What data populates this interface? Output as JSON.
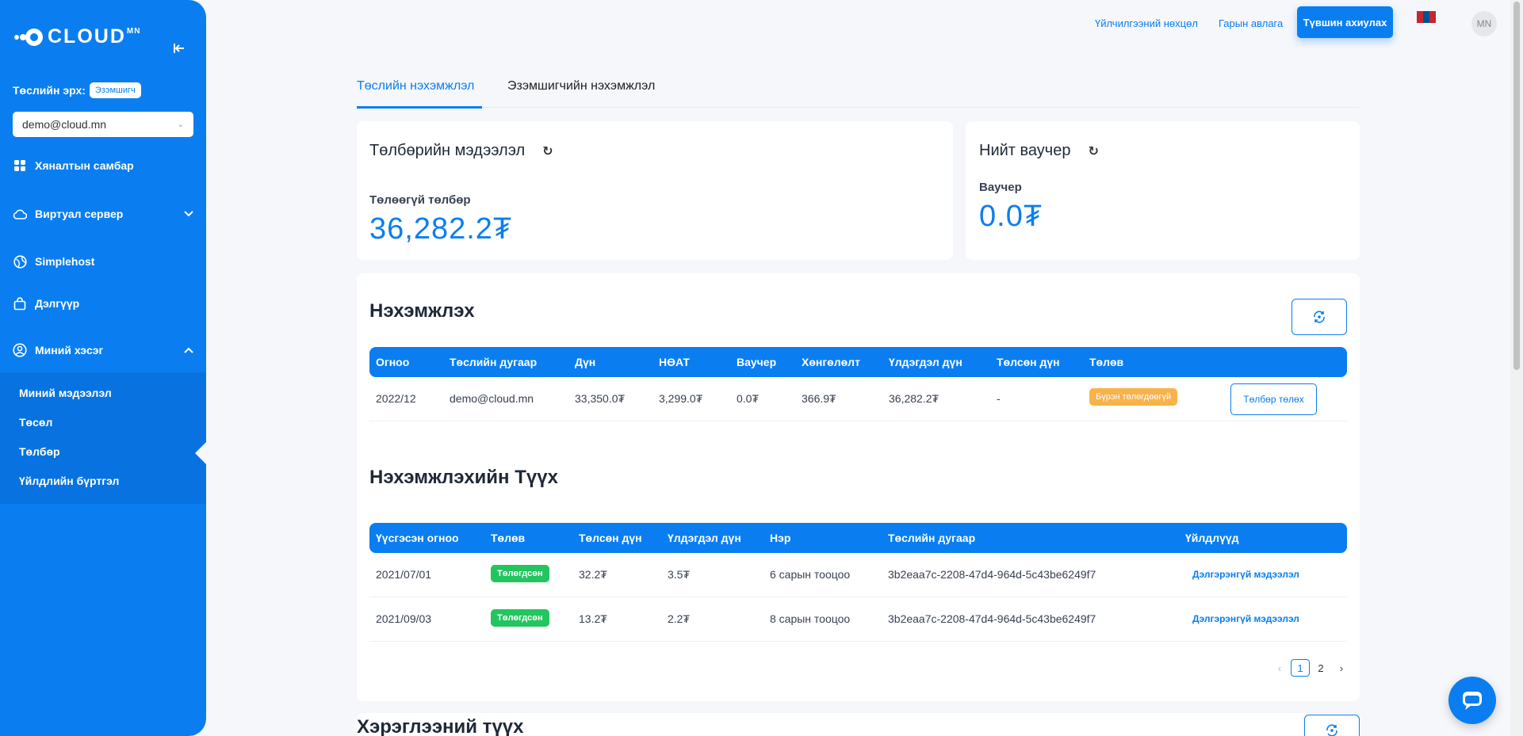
{
  "brand": {
    "logo_text": "CLOUD",
    "logo_sup": "MN"
  },
  "sidebar": {
    "collapse_icon": "collapse-left-icon",
    "account_label": "Төслийн эрх:",
    "account_role": "Эзэмшигч",
    "account_email": "demo@cloud.mn",
    "items": [
      {
        "label": "Хяналтын самбар",
        "icon": "dashboard-icon"
      },
      {
        "label": "Виртуал сервер",
        "icon": "cloud-icon"
      },
      {
        "label": "Simplehost",
        "icon": "globe-icon"
      },
      {
        "label": "Дэлгүүр",
        "icon": "shopping-bag-icon"
      },
      {
        "label": "Миний хэсэг",
        "icon": "user-circle-icon"
      }
    ],
    "submenu": [
      "Миний мэдээлэл",
      "Төсөл",
      "Төлбөр",
      "Үйлдлийн бүртгэл"
    ]
  },
  "topbar": {
    "terms": "Үйлчилгээний нөхцөл",
    "guide": "Гарын авлага",
    "upgrade": "Түвшин ахиулах",
    "avatar": "MN"
  },
  "tabs": [
    "Төслийн нэхэмжлэл",
    "Эзэмшигчийн нэхэмжлэл"
  ],
  "payment_card": {
    "title": "Төлбөрийн мэдээлэл",
    "label": "Төлөөгүй төлбөр",
    "value": "36,282.2₮"
  },
  "voucher_card": {
    "title": "Нийт ваучер",
    "label": "Ваучер",
    "value": "0.0₮"
  },
  "invoice": {
    "title": "Нэхэмжлэх",
    "headers": [
      "Огноо",
      "Төслийн дугаар",
      "Дүн",
      "НӨАТ",
      "Ваучер",
      "Хөнгөлөлт",
      "Үлдэгдэл дүн",
      "Төлсөн дүн",
      "Төлөв"
    ],
    "row": {
      "date": "2022/12",
      "project": "demo@cloud.mn",
      "amount": "33,350.0₮",
      "vat": "3,299.0₮",
      "voucher": "0.0₮",
      "discount": "366.9₮",
      "balance": "36,282.2₮",
      "paid": "-",
      "status": "Бүрэн төлөгдөөгүй",
      "action": "Төлбөр төлөх"
    }
  },
  "history": {
    "title": "Нэхэмжлэхийн Түүх",
    "headers": [
      "Үүсгэсэн огноо",
      "Төлөв",
      "Төлсөн дүн",
      "Үлдэгдэл дүн",
      "Нэр",
      "Төслийн дугаар",
      "Үйлдлүүд"
    ],
    "rows": [
      {
        "date": "2021/07/01",
        "status": "Төлөгдсөн",
        "paid": "32.2₮",
        "balance": "3.5₮",
        "name": "6 сарын тооцоо",
        "project": "3b2eaa7c-2208-47d4-964d-5c43be6249f7",
        "action": "Дэлгэрэнгүй мэдээлэл"
      },
      {
        "date": "2021/09/03",
        "status": "Төлөгдсөн",
        "paid": "13.2₮",
        "balance": "2.2₮",
        "name": "8 сарын тооцоо",
        "project": "3b2eaa7c-2208-47d4-964d-5c43be6249f7",
        "action": "Дэлгэрэнгүй мэдээлэл"
      }
    ],
    "pages": [
      "1",
      "2"
    ]
  },
  "usage": {
    "title": "Хэрэглээний түүх"
  },
  "colors": {
    "primary": "#0a7ef0",
    "success": "#22c55e",
    "warning": "#f9b24a"
  }
}
